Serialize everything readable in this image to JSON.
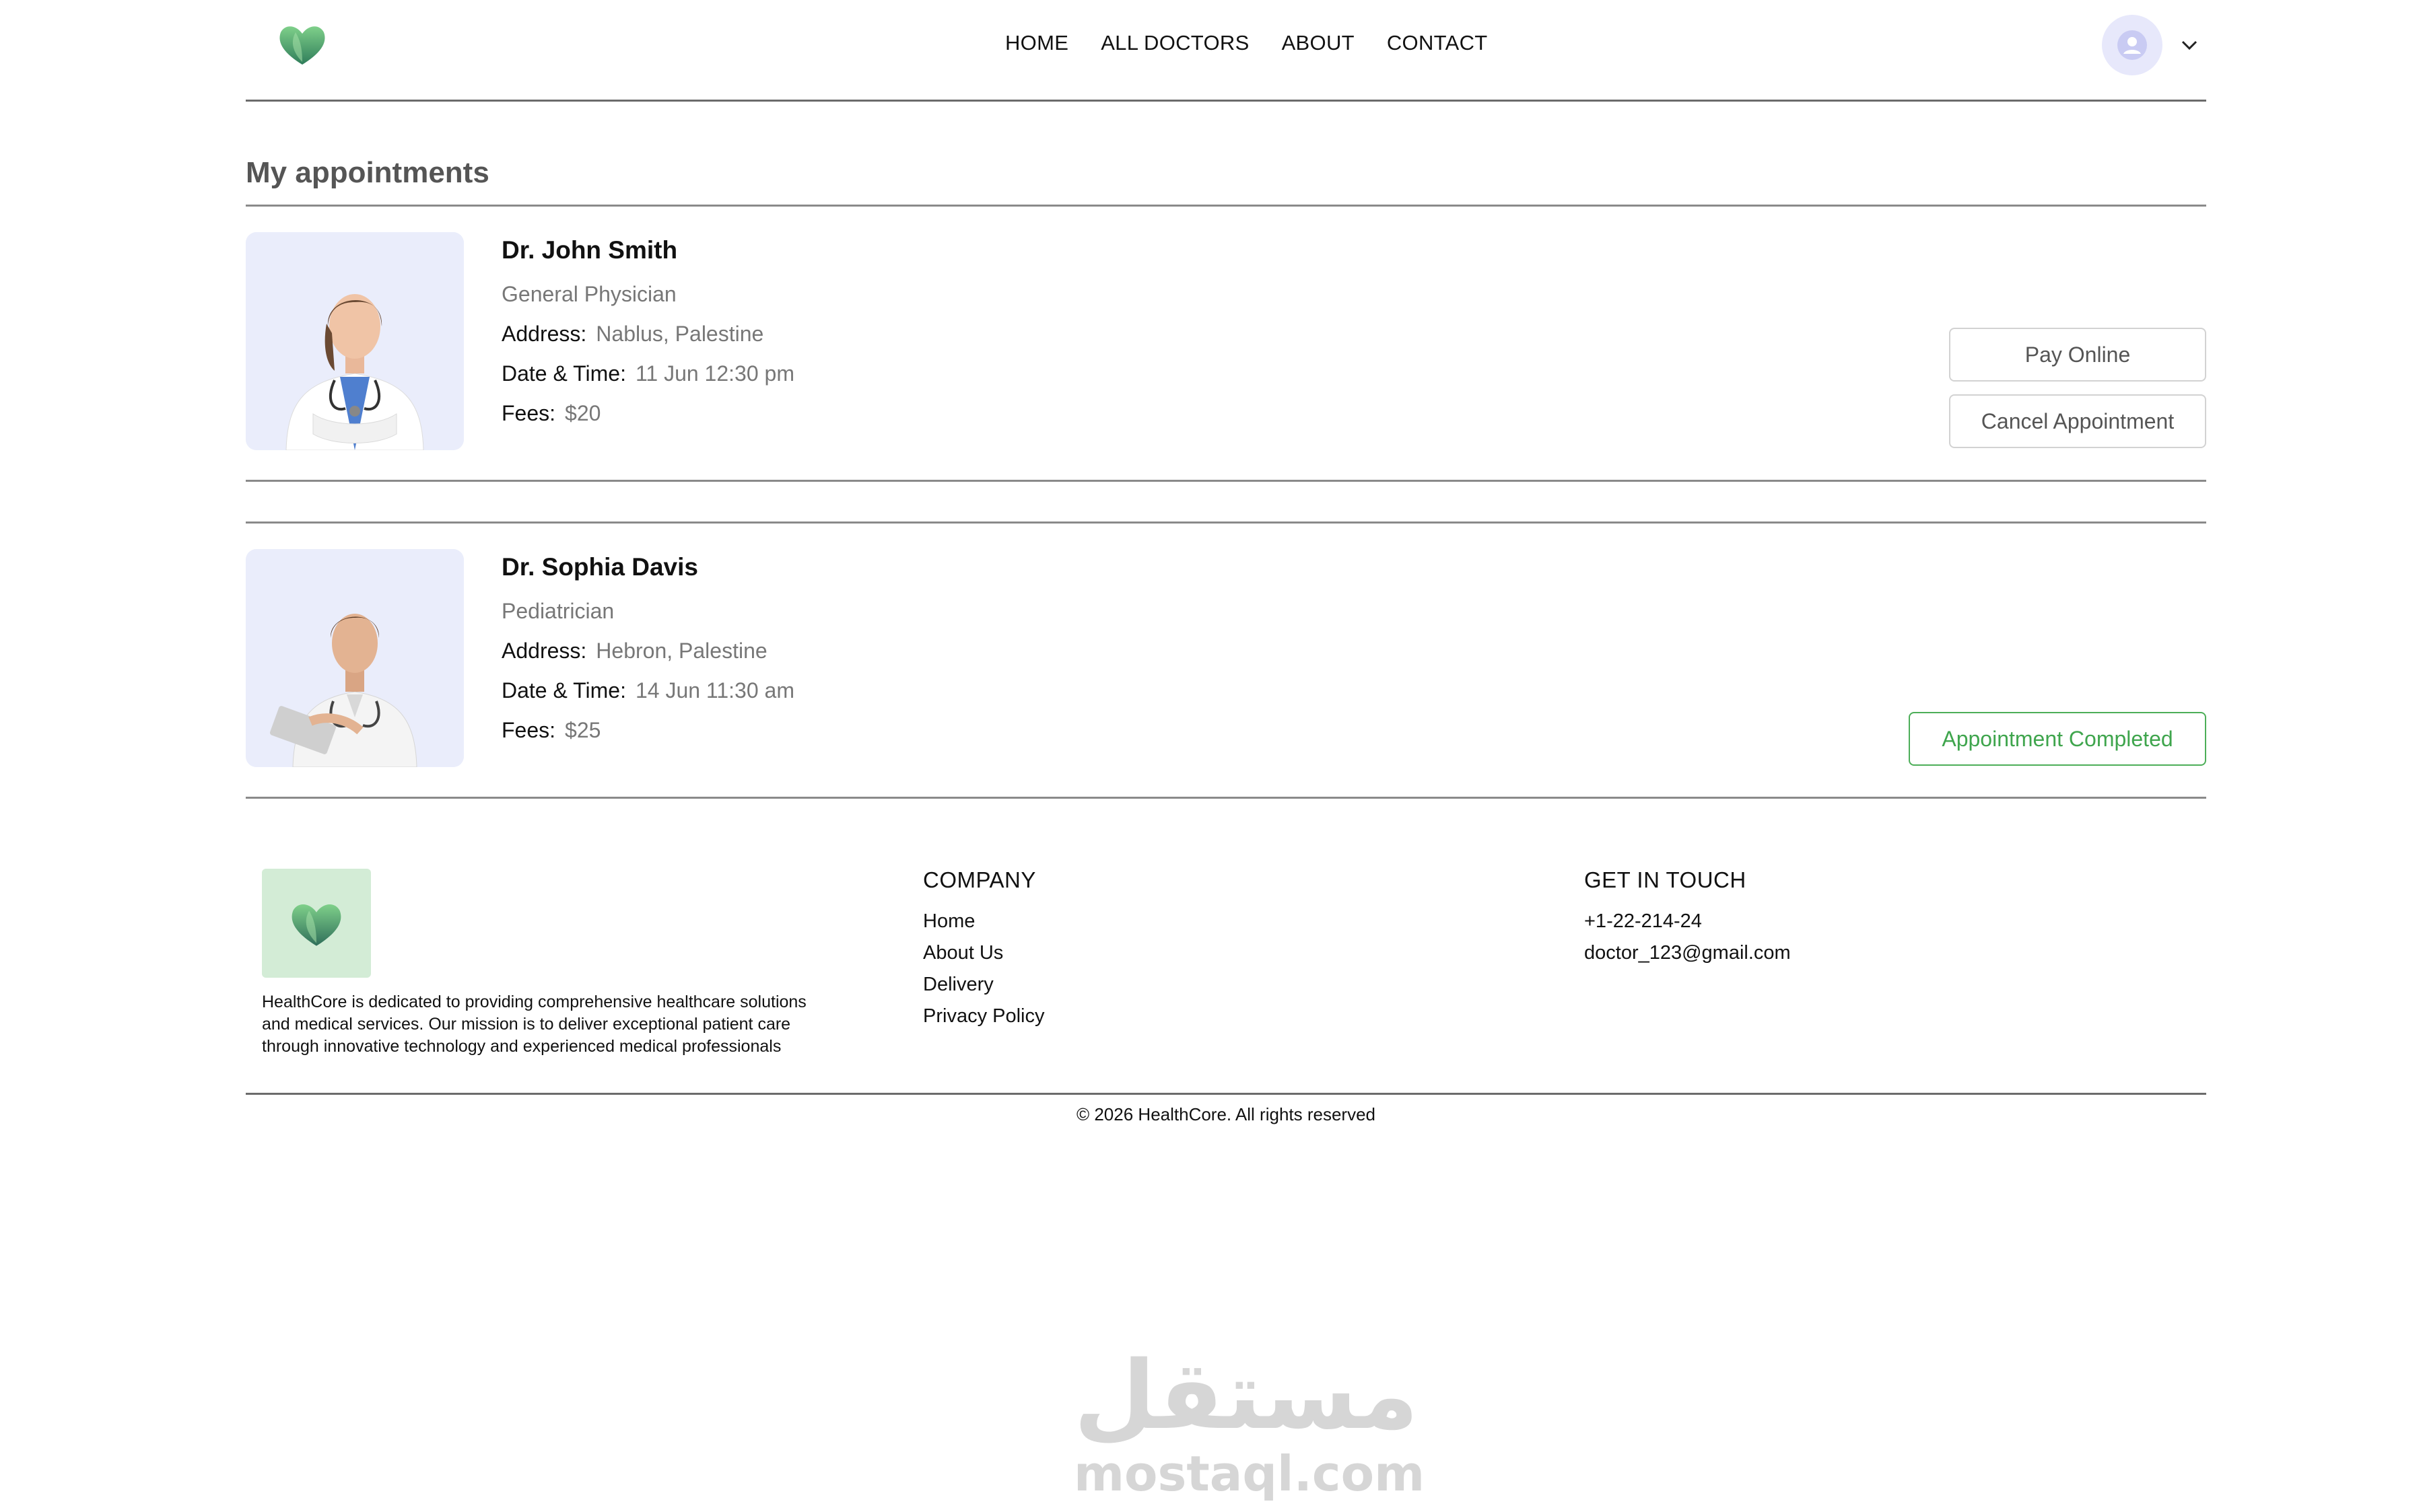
{
  "nav": {
    "links": [
      "HOME",
      "ALL DOCTORS",
      "ABOUT",
      "CONTACT"
    ]
  },
  "page": {
    "title": "My appointments"
  },
  "appointments": [
    {
      "name": "Dr. John Smith",
      "speciality": "General Physician",
      "address_label": "Address:",
      "address": "Nablus, Palestine",
      "datetime_label": "Date & Time:",
      "datetime": "11 Jun 12:30 pm",
      "fees_label": "Fees:",
      "fees": "$20",
      "actions": {
        "pay": "Pay Online",
        "cancel": "Cancel Appointment"
      }
    },
    {
      "name": "Dr. Sophia Davis",
      "speciality": "Pediatrician",
      "address_label": "Address:",
      "address": "Hebron, Palestine",
      "datetime_label": "Date & Time:",
      "datetime": "14 Jun 11:30 am",
      "fees_label": "Fees:",
      "fees": "$25",
      "status": "Appointment Completed"
    }
  ],
  "footer": {
    "description": "HealthCore is dedicated to providing comprehensive healthcare solutions and medical services. Our mission is to deliver exceptional patient care through innovative technology and experienced medical professionals",
    "company": {
      "title": "COMPANY",
      "links": [
        "Home",
        "About Us",
        "Delivery",
        "Privacy Policy"
      ]
    },
    "contact": {
      "title": "GET IN TOUCH",
      "phone": "+1-22-214-24",
      "email": "doctor_123@gmail.com"
    },
    "copyright": "© 2026 HealthCore. All rights reserved"
  },
  "watermark": {
    "arabic": "مستقل",
    "latin": "mostaql.com"
  },
  "colors": {
    "accent_green": "#4cae58",
    "photo_bg": "#eaedfb",
    "avatar_bg": "#e7e8fb"
  },
  "icons": {
    "logo": "leaf-heart-icon",
    "avatar": "user-avatar-icon",
    "dropdown": "chevron-down-icon"
  }
}
